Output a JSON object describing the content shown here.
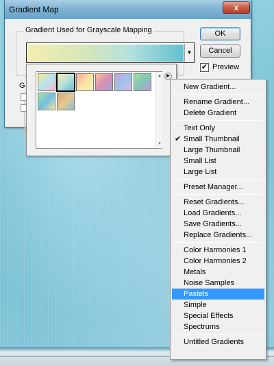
{
  "dialog": {
    "title": "Gradient Map",
    "close_label": "x",
    "group_label": "Gradient Used for Grayscale Mapping",
    "ok_label": "OK",
    "cancel_label": "Cancel",
    "preview_label": "Preview",
    "preview_checked": true,
    "options_glyph": "G"
  },
  "preset_picker": {
    "gradients": [
      {
        "name": "pastel-1",
        "colors": [
          "#f6e98f",
          "#b9e3f0",
          "#f7b9c9"
        ]
      },
      {
        "name": "pastel-2",
        "colors": [
          "#f3edb2",
          "#b5e1de",
          "#62c0cf"
        ]
      },
      {
        "name": "pastel-3",
        "colors": [
          "#f5a6a2",
          "#f8e3a1",
          "#f7f3c4"
        ]
      },
      {
        "name": "pastel-4",
        "colors": [
          "#f7c09d",
          "#d58fb3",
          "#a3a1dc"
        ]
      },
      {
        "name": "pastel-5",
        "colors": [
          "#c7a0dc",
          "#9ec4e8",
          "#d8b6e4"
        ]
      },
      {
        "name": "pastel-6",
        "colors": [
          "#a6dd9c",
          "#7fc6b6",
          "#c897d6"
        ]
      },
      {
        "name": "pastel-7",
        "colors": [
          "#9fe5a2",
          "#72bde0",
          "#f6e39b"
        ]
      },
      {
        "name": "pastel-8",
        "colors": [
          "#cfa97a",
          "#e9c78d",
          "#7fc3d9"
        ]
      }
    ]
  },
  "menu": {
    "items": [
      {
        "label": "New Gradient...",
        "type": "item"
      },
      {
        "type": "sep"
      },
      {
        "label": "Rename Gradient...",
        "type": "item"
      },
      {
        "label": "Delete Gradient",
        "type": "item"
      },
      {
        "type": "sep"
      },
      {
        "label": "Text Only",
        "type": "item"
      },
      {
        "label": "Small Thumbnail",
        "type": "item",
        "checked": true
      },
      {
        "label": "Large Thumbnail",
        "type": "item"
      },
      {
        "label": "Small List",
        "type": "item"
      },
      {
        "label": "Large List",
        "type": "item"
      },
      {
        "type": "sep"
      },
      {
        "label": "Preset Manager...",
        "type": "item"
      },
      {
        "type": "sep"
      },
      {
        "label": "Reset Gradients...",
        "type": "item"
      },
      {
        "label": "Load Gradients...",
        "type": "item"
      },
      {
        "label": "Save Gradients...",
        "type": "item"
      },
      {
        "label": "Replace Gradients...",
        "type": "item"
      },
      {
        "type": "sep"
      },
      {
        "label": "Color Harmonies 1",
        "type": "item"
      },
      {
        "label": "Color Harmonies 2",
        "type": "item"
      },
      {
        "label": "Metals",
        "type": "item"
      },
      {
        "label": "Noise Samples",
        "type": "item"
      },
      {
        "label": "Pastels",
        "type": "item",
        "highlighted": true
      },
      {
        "label": "Simple",
        "type": "item"
      },
      {
        "label": "Special Effects",
        "type": "item"
      },
      {
        "label": "Spectrums",
        "type": "item"
      },
      {
        "type": "sep"
      },
      {
        "label": "Untitled Gradients",
        "type": "item"
      }
    ],
    "check_glyph": "✔"
  },
  "colors": {
    "highlight": "#3399ff",
    "title_bar": "#7fb3d4"
  }
}
